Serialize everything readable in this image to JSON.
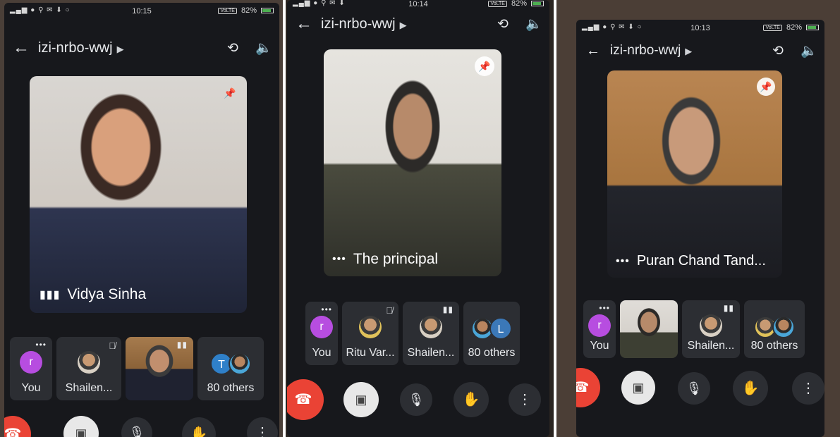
{
  "panels": [
    {
      "status": {
        "time": "10:15",
        "volte": "VoLTE",
        "battery": "82%"
      },
      "meeting_code": "izi-nrbo-wwj",
      "main_speaker": {
        "name": "Vidya Sinha"
      },
      "thumbnails": [
        {
          "label": "You",
          "avatar_letter": "r"
        },
        {
          "label": "Shailen..."
        },
        {
          "label": ""
        },
        {
          "label": "80 others",
          "avatar_letter": "T"
        }
      ]
    },
    {
      "status": {
        "time": "10:14",
        "volte": "VoLTE",
        "battery": "82%"
      },
      "meeting_code": "izi-nrbo-wwj",
      "main_speaker": {
        "name": "The principal"
      },
      "thumbnails": [
        {
          "label": "You",
          "avatar_letter": "r"
        },
        {
          "label": "Ritu Var..."
        },
        {
          "label": "Shailen..."
        },
        {
          "label": "80 others",
          "avatar_letter": "L"
        }
      ]
    },
    {
      "status": {
        "time": "10:13",
        "volte": "VoLTE",
        "battery": "82%"
      },
      "meeting_code": "izi-nrbo-wwj",
      "main_speaker": {
        "name": "Puran Chand Tand..."
      },
      "thumbnails": [
        {
          "label": "You",
          "avatar_letter": "r"
        },
        {
          "label": ""
        },
        {
          "label": "Shailen..."
        },
        {
          "label": "80 others"
        }
      ]
    }
  ],
  "icons": {
    "back": "back-arrow-icon",
    "meeting_info": "chevron-right-icon",
    "switch_camera": "switch-camera-icon",
    "audio_output": "speaker-icon",
    "pin": "pin-icon",
    "end_call": "end-call-icon",
    "camera_off": "camera-off-icon",
    "mic": "mic-icon",
    "raise_hand": "hand-icon",
    "more": "more-vertical-icon"
  },
  "colors": {
    "end_call": "#ea4335",
    "avatar_purple": "#b74de0",
    "pin_blue": "#1a73e8",
    "app_bg": "#17181c"
  }
}
